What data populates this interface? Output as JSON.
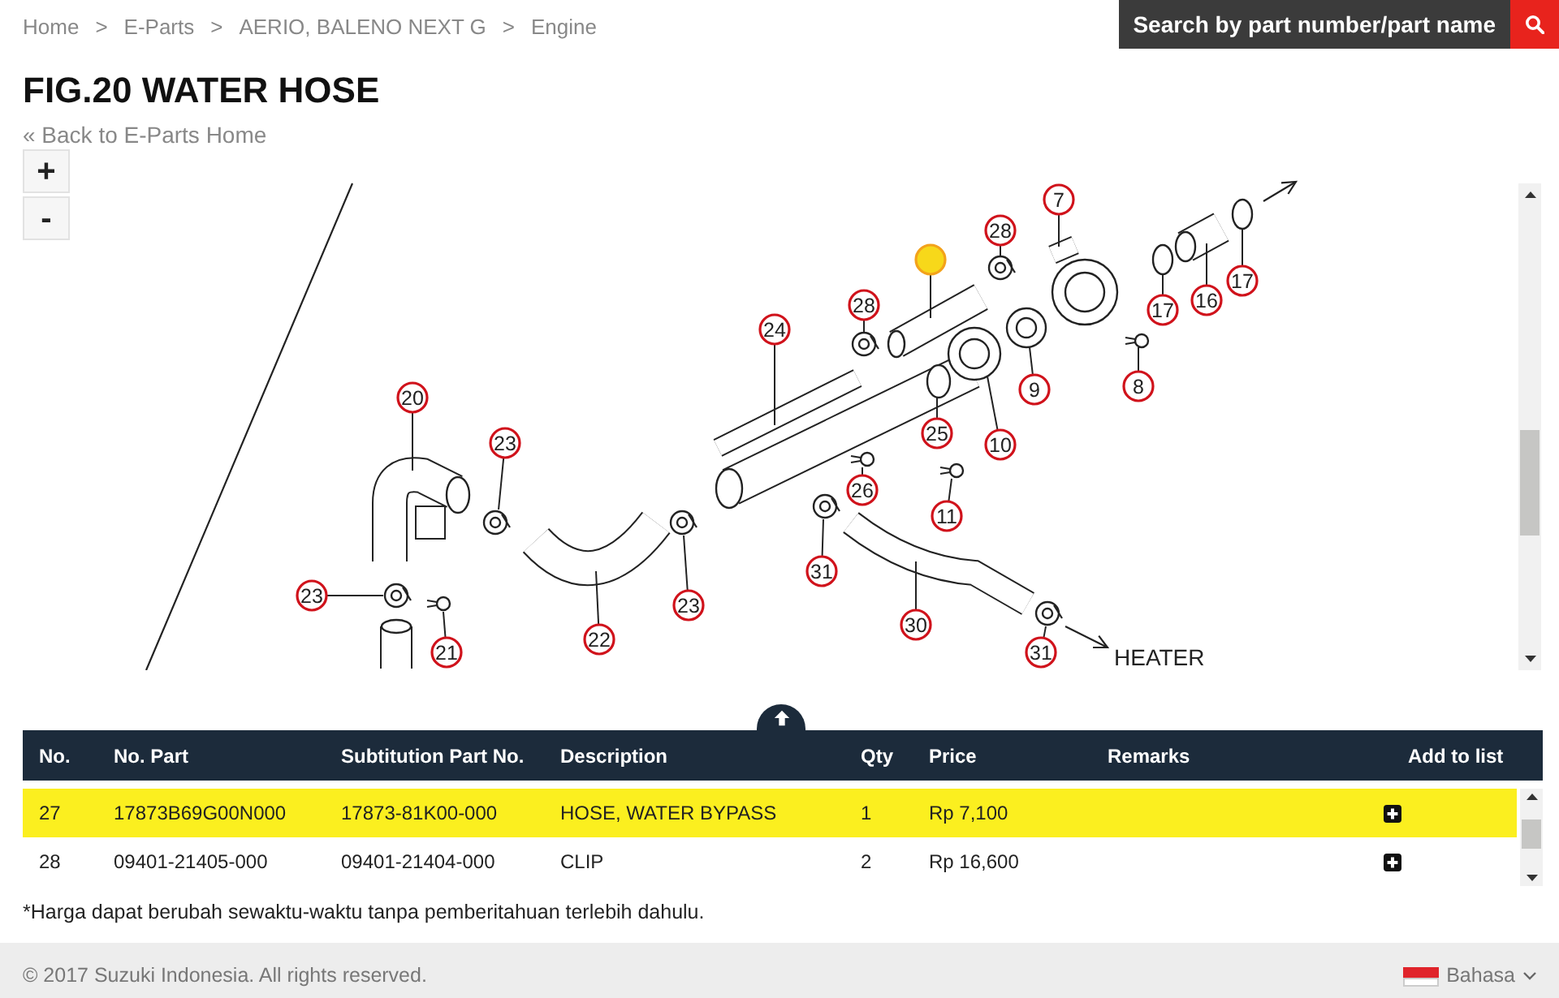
{
  "breadcrumb": {
    "separator": ">",
    "items": [
      {
        "label": "Home"
      },
      {
        "label": "E-Parts"
      },
      {
        "label": "AERIO, BALENO NEXT G"
      },
      {
        "label": "Engine"
      }
    ]
  },
  "search": {
    "label": "Search by part number/part name"
  },
  "title": "FIG.20 WATER HOSE",
  "back_link": "« Back to E-Parts Home",
  "diagram": {
    "zoom_in": "+",
    "zoom_out": "-",
    "label": "HEATER",
    "callouts": [
      {
        "number": "7",
        "selected": false
      },
      {
        "number": "28",
        "selected": false
      },
      {
        "selected": true
      },
      {
        "number": "28",
        "selected": false
      },
      {
        "number": "24",
        "selected": false
      },
      {
        "number": "17",
        "selected": false
      },
      {
        "number": "16",
        "selected": false
      },
      {
        "number": "17",
        "selected": false
      },
      {
        "number": "8",
        "selected": false
      },
      {
        "number": "9",
        "selected": false
      },
      {
        "number": "20",
        "selected": false
      },
      {
        "number": "25",
        "selected": false
      },
      {
        "number": "10",
        "selected": false
      },
      {
        "number": "23",
        "selected": false
      },
      {
        "number": "26",
        "selected": false
      },
      {
        "number": "11",
        "selected": false
      },
      {
        "number": "31",
        "selected": false
      },
      {
        "number": "23",
        "selected": false
      },
      {
        "number": "23",
        "selected": false
      },
      {
        "number": "30",
        "selected": false
      },
      {
        "number": "22",
        "selected": false
      },
      {
        "number": "21",
        "selected": false
      },
      {
        "number": "31",
        "selected": false
      }
    ]
  },
  "table": {
    "columns": [
      "No.",
      "No. Part",
      "Subtitution Part No.",
      "Description",
      "Qty",
      "Price",
      "Remarks",
      "Add to list"
    ],
    "rows": [
      {
        "cells": [
          "27",
          "17873B69G00N000",
          "17873-81K00-000",
          "HOSE, WATER BYPASS",
          "1",
          "Rp 7,100"
        ],
        "selected": true
      },
      {
        "cells": [
          "28",
          "09401-21405-000",
          "09401-21404-000",
          "CLIP",
          "2",
          "Rp 16,600"
        ],
        "selected": false
      }
    ]
  },
  "footnote": "*Harga dapat berubah sewaktu-waktu tanpa pemberitahuan terlebih dahulu.",
  "footer": {
    "copyright": "© 2017 Suzuki Indonesia. All rights reserved.",
    "language": "Bahasa"
  }
}
